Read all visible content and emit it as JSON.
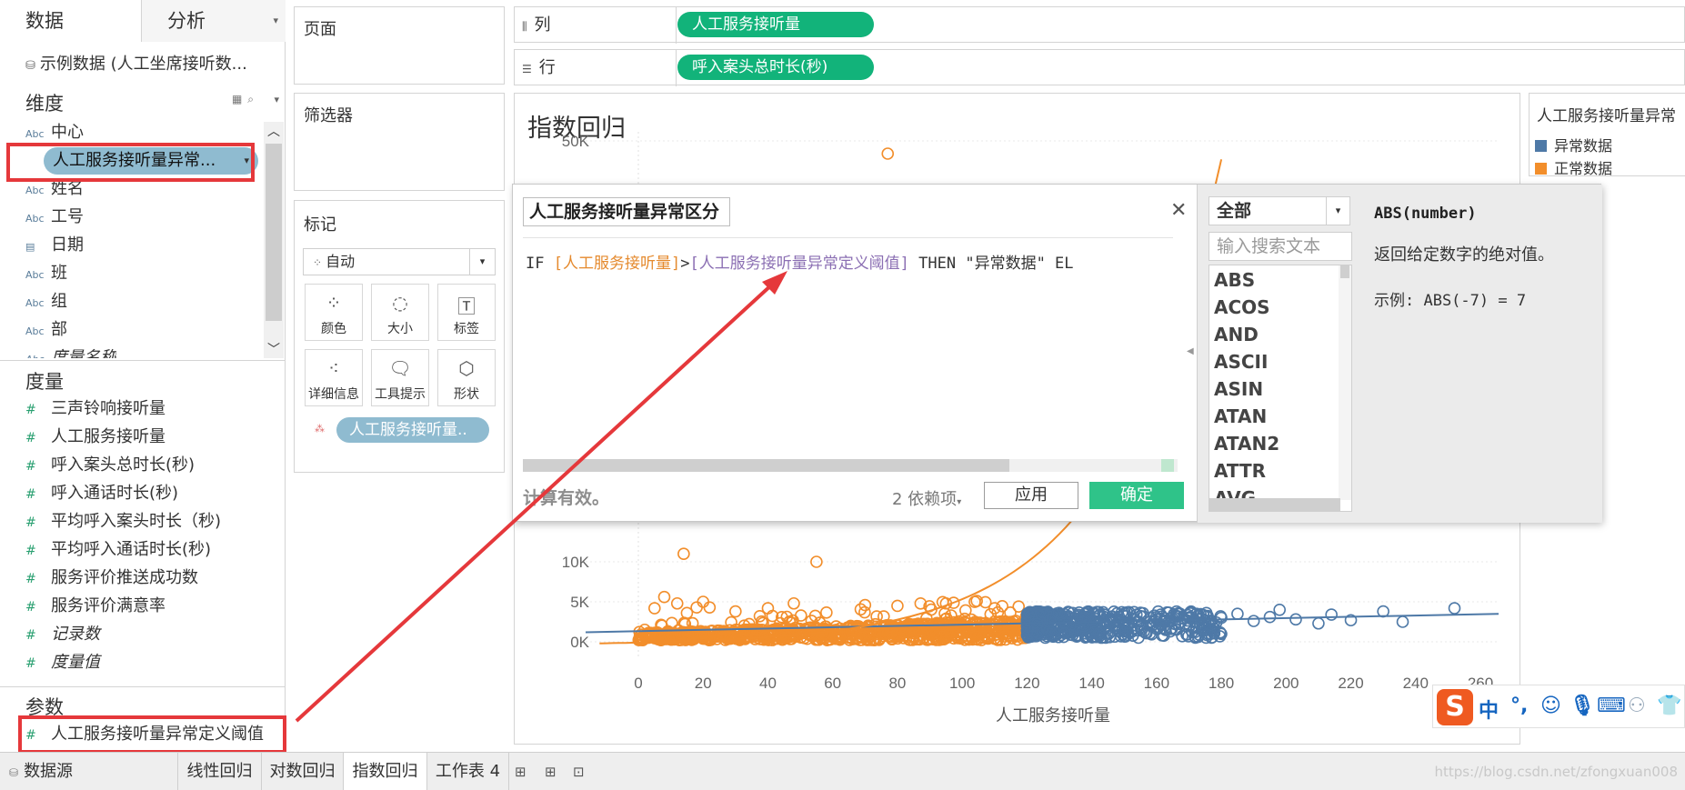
{
  "left_pane": {
    "tab_data": "数据",
    "tab_analysis": "分析",
    "datasource": "示例数据 (人工坐席接听数...",
    "dimensions_title": "维度",
    "dimensions": [
      {
        "type": "Abc",
        "label": "中心"
      },
      {
        "type": "Abc",
        "label": "人工服务接听量异常..."
      },
      {
        "type": "Abc",
        "label": "姓名"
      },
      {
        "type": "Abc",
        "label": "工号"
      },
      {
        "type": "date",
        "label": "日期"
      },
      {
        "type": "Abc",
        "label": "班"
      },
      {
        "type": "Abc",
        "label": "组"
      },
      {
        "type": "Abc",
        "label": "部"
      },
      {
        "type": "Abc",
        "label": "度量名称"
      }
    ],
    "measures_title": "度量",
    "measures": [
      {
        "label": "三声铃响接听量",
        "italic": false
      },
      {
        "label": "人工服务接听量",
        "italic": false
      },
      {
        "label": "呼入案头总时长(秒)",
        "italic": false
      },
      {
        "label": "呼入通话时长(秒)",
        "italic": false
      },
      {
        "label": "平均呼入案头时长（秒)",
        "italic": false
      },
      {
        "label": "平均呼入通话时长(秒)",
        "italic": false
      },
      {
        "label": "服务评价推送成功数",
        "italic": false
      },
      {
        "label": "服务评价满意率",
        "italic": false
      },
      {
        "label": "记录数",
        "italic": true
      },
      {
        "label": "度量值",
        "italic": true
      }
    ],
    "parameters_title": "参数",
    "parameters": [
      "人工服务接听量异常定义阈值"
    ]
  },
  "shelves": {
    "pages_label": "页面",
    "filters_label": "筛选器",
    "marks_label": "标记",
    "mark_type": "自动",
    "mark_buttons": [
      {
        "label": "颜色",
        "icon": "color-dots-icon"
      },
      {
        "label": "大小",
        "icon": "size-icon"
      },
      {
        "label": "标签",
        "icon": "label-icon"
      },
      {
        "label": "详细信息",
        "icon": "detail-icon"
      },
      {
        "label": "工具提示",
        "icon": "tooltip-icon"
      },
      {
        "label": "形状",
        "icon": "shape-icon"
      }
    ],
    "mark_pill": "人工服务接听量..",
    "columns_label": "列",
    "rows_label": "行",
    "columns_pill": "人工服务接听量",
    "rows_pill": "呼入案头总时长(秒)"
  },
  "view": {
    "title": "指数回归",
    "x_axis_label": "人工服务接听量",
    "x_ticks": [
      "0",
      "20",
      "40",
      "60",
      "80",
      "100",
      "120",
      "140",
      "160",
      "180",
      "200",
      "220",
      "240",
      "260"
    ],
    "y_ticks_visible": [
      "0K",
      "5K",
      "10K",
      "50K"
    ]
  },
  "legend": {
    "title": "人工服务接听量异常",
    "items": [
      {
        "label": "异常数据",
        "color": "#4e79a7"
      },
      {
        "label": "正常数据",
        "color": "#f28e2b"
      }
    ]
  },
  "calc_dialog": {
    "name": "人工服务接听量异常区分",
    "formula_if": "IF ",
    "formula_field": "[人工服务接听量]",
    "formula_op": ">",
    "formula_param": "[人工服务接听量异常定义阈值]",
    "formula_then": "  THEN \"异常数据\" EL",
    "status": "计算有效。",
    "dependencies": "2 依赖项",
    "apply": "应用",
    "ok": "确定",
    "function_category": "全部",
    "search_placeholder": "输入搜索文本",
    "functions": [
      "ABS",
      "ACOS",
      "AND",
      "ASCII",
      "ASIN",
      "ATAN",
      "ATAN2",
      "ATTR",
      "AVG"
    ],
    "help_signature": "ABS(number)",
    "help_description": "返回给定数字的绝对值。",
    "help_example": "示例: ABS(-7) = 7"
  },
  "bottom_tabs": {
    "datasource": "数据源",
    "sheets": [
      "线性回归",
      "对数回归",
      "指数回归",
      "工作表 4"
    ],
    "active": "指数回归"
  },
  "ime": {
    "lang": "中",
    "punct": "°,"
  },
  "watermark": "https://blog.csdn.net/zfongxuan008",
  "chart_data": {
    "type": "scatter",
    "xlabel": "人工服务接听量",
    "x_ticks": [
      0,
      20,
      40,
      60,
      80,
      100,
      120,
      140,
      160,
      180,
      200,
      220,
      240,
      260
    ],
    "y_ticks": [
      "0K",
      "5K",
      "10K",
      "50K"
    ],
    "series": [
      {
        "name": "正常数据",
        "color": "#f28e2b",
        "x_range": [
          0,
          120
        ],
        "y_range": [
          0,
          12000
        ]
      },
      {
        "name": "异常数据",
        "color": "#4e79a7",
        "x_range": [
          120,
          252
        ],
        "y_range": [
          0,
          4000
        ]
      }
    ],
    "trend_lines": [
      "linear",
      "exponential"
    ]
  }
}
